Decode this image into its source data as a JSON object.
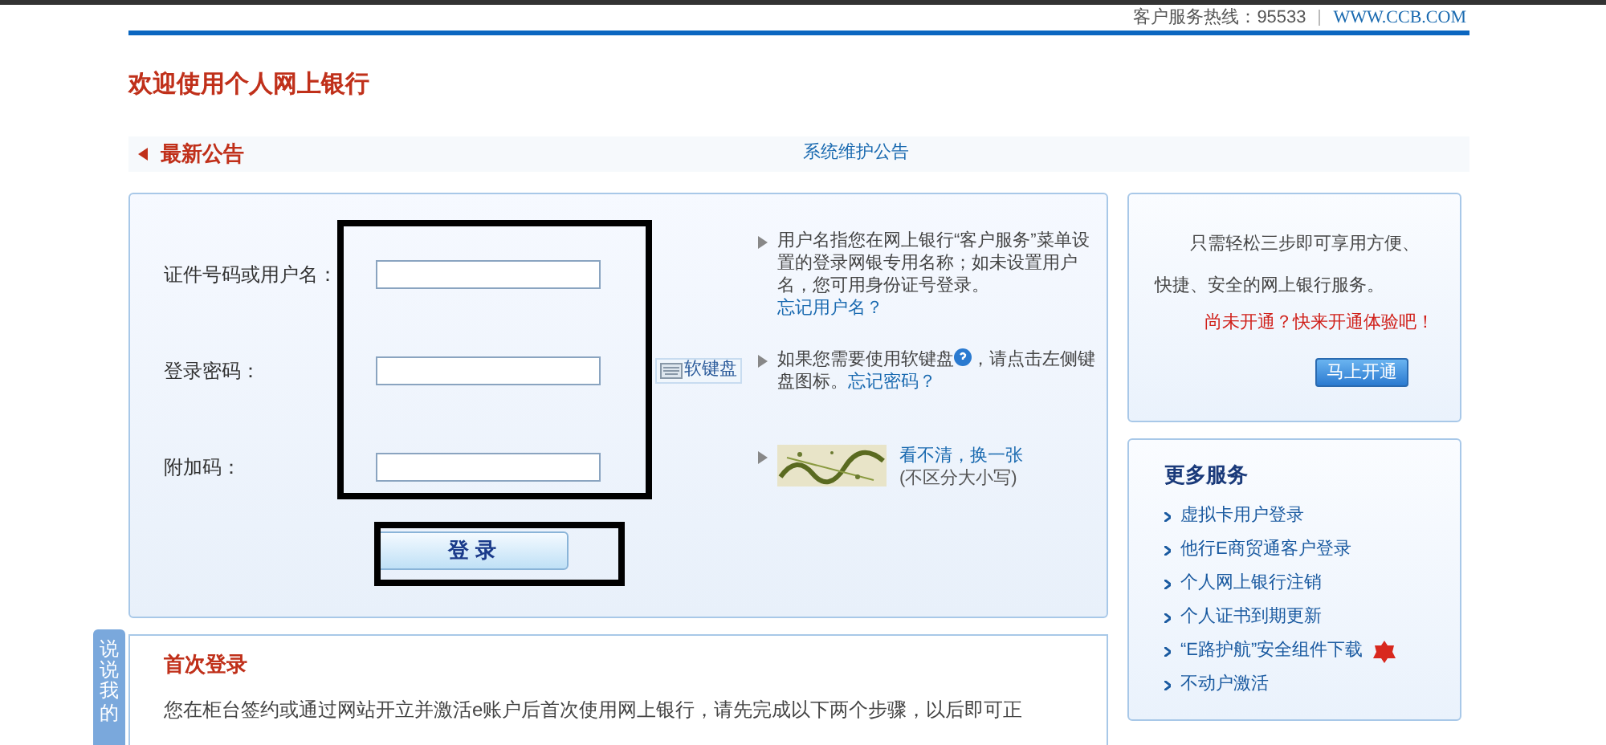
{
  "header": {
    "hotline_label": "客户服务热线：95533",
    "site_link": "WWW.CCB.COM"
  },
  "page_title": "欢迎使用个人网上银行",
  "notice": {
    "title": "最新公告",
    "link": "系统维护公告"
  },
  "login": {
    "fields": [
      {
        "label": "证件号码或用户名：",
        "hint": "用户名指您在网上银行“客户服务”菜单设置的登录网银专用名称；如未设置用户名，您可用身份证号登录。",
        "link": "忘记用户名？",
        "kind": "text"
      },
      {
        "label": "登录密码：",
        "hint": "如果您需要使用软键盘",
        "hint_after": "，请点击左侧键盘图标。",
        "link": "忘记密码？",
        "kind": "password",
        "keyboard": "软键盘"
      },
      {
        "label": "附加码：",
        "kind": "captcha",
        "refresh": "看不清，换一张",
        "note": "(不区分大小写)"
      }
    ],
    "submit": "登 录"
  },
  "first_login": {
    "title": "首次登录",
    "text": "您在柜台签约或通过网站开立并激活e账户后首次使用网上银行，请先完成以下两个步骤，以后即可正"
  },
  "promo": {
    "text": "只需轻松三步即可享用方便、快捷、安全的网上银行服务。",
    "cta": "尚未开通？快来开通体验吧！",
    "button": "马上开通"
  },
  "more_services": {
    "title": "更多服务",
    "items": [
      {
        "label": "虚拟卡用户登录",
        "hot": false
      },
      {
        "label": "他行E商贸通客户登录",
        "hot": false
      },
      {
        "label": "个人网上银行注销",
        "hot": false
      },
      {
        "label": "个人证书到期更新",
        "hot": false
      },
      {
        "label": "“E路护航”安全组件下载",
        "hot": true
      },
      {
        "label": "不动户激活",
        "hot": false
      }
    ]
  },
  "feedback_tab": "说说我的"
}
